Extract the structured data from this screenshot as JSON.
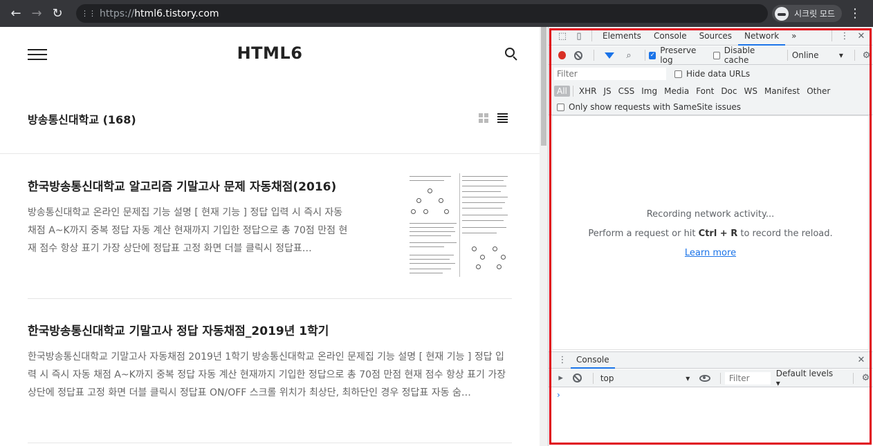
{
  "browser": {
    "url_scheme": "https://",
    "url_host": "html6.tistory.com",
    "incognito_label": "시크릿 모드"
  },
  "site": {
    "title": "HTML6",
    "category": "방송통신대학교 (168)"
  },
  "posts": [
    {
      "title": "한국방송통신대학교 알고리즘 기말고사 문제 자동채점(2016)",
      "excerpt": "방송통신대학교 온라인 문제집 기능 설명 [ 현재 기능 ] 정답 입력 시 즉시 자동 채점 A~K까지 중복 정답 자동 계산 현재까지 기입한 정답으로 총 70점 만점 현재 점수 항상 표기 가장 상단에 정답표 고정 화면 더블 클릭시 정답표…"
    },
    {
      "title": "한국방송통신대학교 기말고사 정답 자동채점_2019년 1학기",
      "excerpt": "한국방송통신대학교 기말고사 자동채점 2019년 1학기 방송통신대학교 온라인 문제집 기능 설명 [ 현재 기능 ] 정답 입력 시 즉시 자동 채점 A~K까지 중복 정답 자동 계산 현재까지 기입한 정답으로 총 70점 만점 현재 점수 항상 표기 가장 상단에 정답표 고정 화면 더블 클릭시 정답표 ON/OFF 스크롤 위치가 최상단, 최하단인 경우 정답표 자동 숨…"
    }
  ],
  "devtools": {
    "tabs": [
      "Elements",
      "Console",
      "Sources",
      "Network"
    ],
    "more": "»",
    "preserve_log": "Preserve log",
    "disable_cache": "Disable cache",
    "throttle": "Online",
    "filter_placeholder": "Filter",
    "hide_data_urls": "Hide data URLs",
    "types": [
      "All",
      "XHR",
      "JS",
      "CSS",
      "Img",
      "Media",
      "Font",
      "Doc",
      "WS",
      "Manifest",
      "Other"
    ],
    "samesite": "Only show requests with SameSite issues",
    "empty_line1": "Recording network activity...",
    "empty_line2_a": "Perform a request or hit ",
    "empty_line2_keys": "Ctrl + R",
    "empty_line2_b": " to record the reload.",
    "learn_more": "Learn more",
    "drawer_tab": "Console",
    "context": "top",
    "console_filter": "Filter",
    "levels": "Default levels",
    "prompt": "›"
  },
  "colors": {
    "highlight": "#e00010",
    "accent": "#1a73e8",
    "record": "#d93025"
  }
}
